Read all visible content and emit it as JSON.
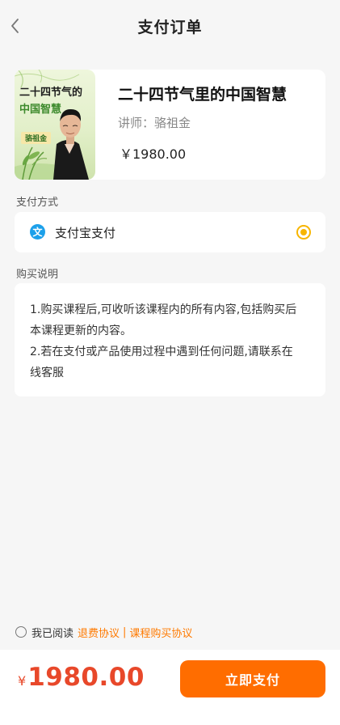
{
  "header": {
    "title": "支付订单"
  },
  "course": {
    "cover_title_line1": "二十四节气的",
    "cover_title_line2": "中国智慧",
    "cover_teacher": "骆祖金",
    "name": "二十四节气里的中国智慧",
    "teacher": "讲师：骆祖金",
    "price": "￥1980.00"
  },
  "payment": {
    "section_label": "支付方式",
    "method_icon": "文",
    "method_label": "支付宝支付",
    "selected": true
  },
  "description": {
    "section_label": "购买说明",
    "line1": "1.购买课程后,可收听该课程内的所有内容,包括购买后",
    "line2": "本课程更新的内容。",
    "line3": "2.若在支付或产品使用过程中遇到任何问题,请联系在",
    "line4": "线客服"
  },
  "agreement": {
    "prefix": "我已阅读",
    "link1": "退费协议",
    "separator": "|",
    "link2": "课程购买协议",
    "checked": false
  },
  "footer": {
    "currency": "¥",
    "total": "1980.00",
    "button": "立即支付"
  },
  "colors": {
    "accent": "#ff6d00",
    "price": "#e8482a",
    "radio": "#f7b500",
    "alipay": "#1ca0ea"
  }
}
